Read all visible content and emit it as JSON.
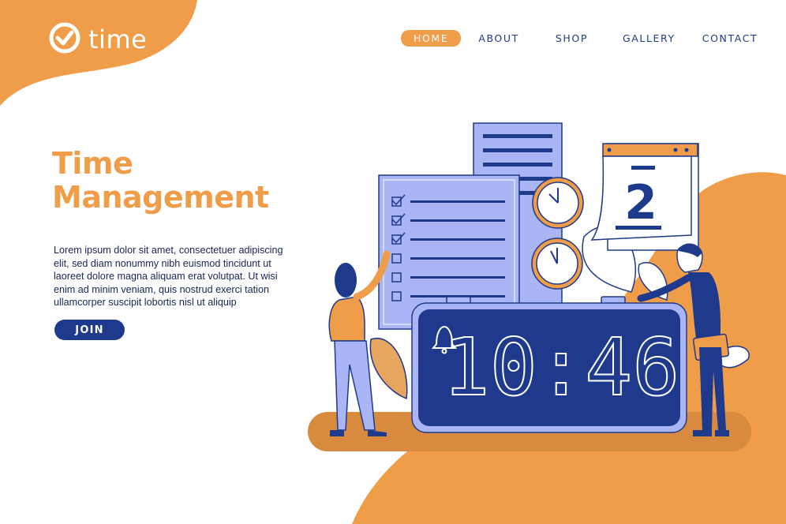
{
  "brand": {
    "name": "time",
    "icon": "check-clock-icon"
  },
  "nav": {
    "items": [
      {
        "label": "HOME",
        "active": true
      },
      {
        "label": "ABOUT",
        "active": false
      },
      {
        "label": "SHOP",
        "active": false
      },
      {
        "label": "GALLERY",
        "active": false
      },
      {
        "label": "CONTACT",
        "active": false
      }
    ]
  },
  "hero": {
    "title_line1": "Time",
    "title_line2": "Management",
    "body_line1": "Lorem ipsum dolor sit amet, consectetuer adipiscing",
    "body_line2": "elit, sed diam nonummy nibh euismod tincidunt ut",
    "body_line3": "laoreet dolore magna aliquam erat volutpat. Ut wisi",
    "body_line4": "enim ad minim veniam, quis nostrud exerci tation",
    "body_line5": "ullamcorper suscipit lobortis nisl ut aliquip",
    "cta_label": "JOIN"
  },
  "illustration": {
    "alarm_clock_time": "10:46",
    "calendar_day": "2",
    "checklist_checked": 3,
    "checklist_total": 6
  },
  "colors": {
    "accent_orange": "#f09d4a",
    "navy": "#1e3a8a",
    "lavender": "#aab5f5",
    "white": "#ffffff"
  }
}
